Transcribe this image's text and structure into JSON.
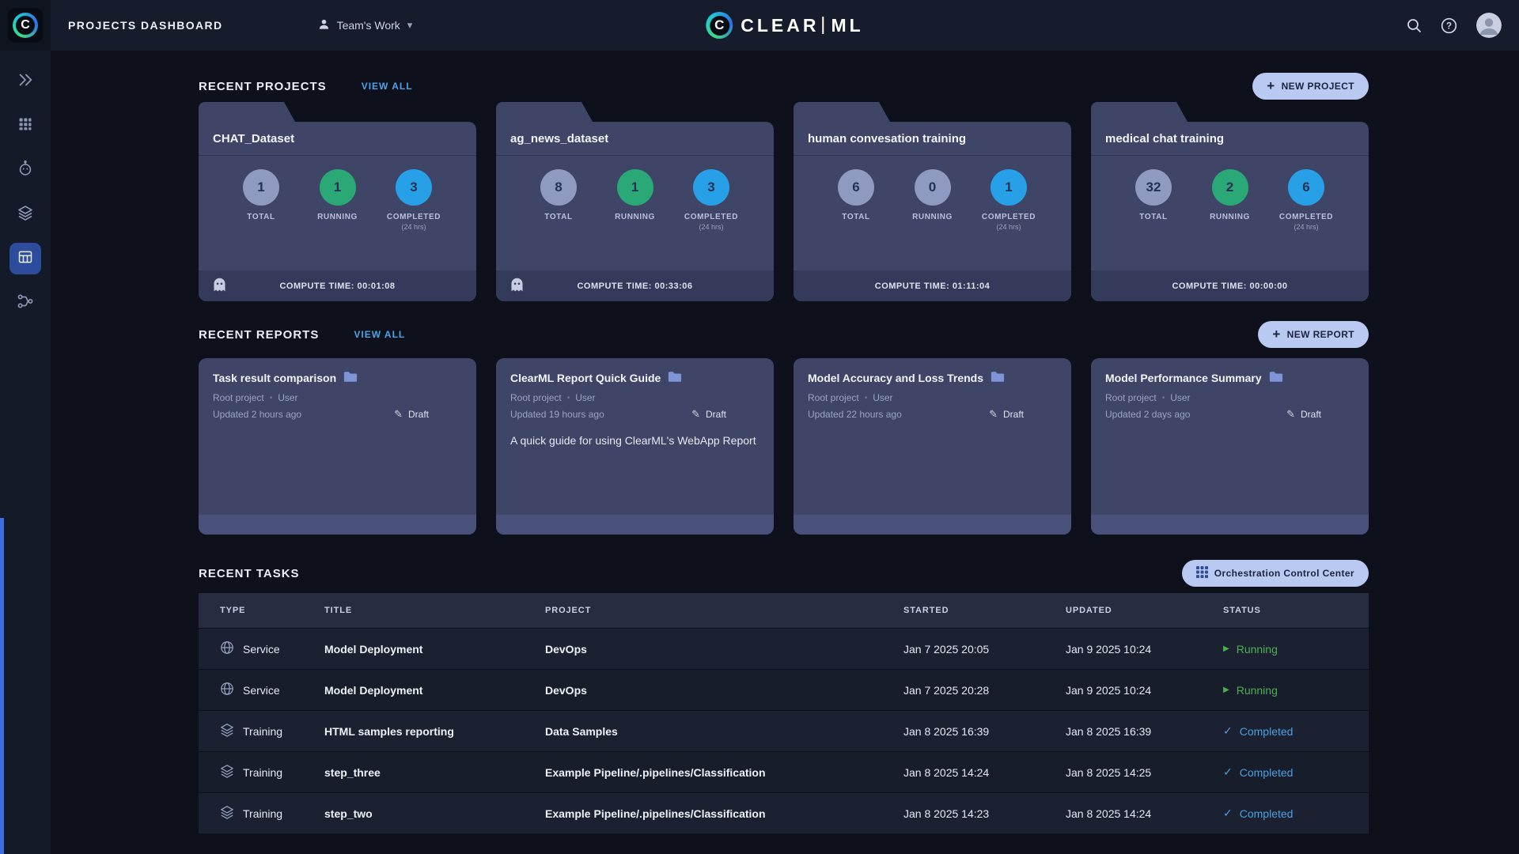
{
  "topbar": {
    "page_title": "PROJECTS DASHBOARD",
    "workspace": "Team's Work",
    "logo": {
      "c": "C",
      "word_left": "CLEAR",
      "word_right": "ML"
    }
  },
  "icons": {
    "caret_down": "▾",
    "plus": "+",
    "pencil": "✎",
    "dot": "•",
    "running": "▶",
    "completed": "✓"
  },
  "colors": {
    "accent_link": "#4ba3e8",
    "running_green": "#4caf50",
    "completed_blue": "#4aa0e0",
    "button_bg": "#b9c9f1",
    "total_gray": "#8e9ac0",
    "running_circle": "#2aa876",
    "completed_circle": "#28a0e8"
  },
  "sections": {
    "projects": {
      "title": "RECENT PROJECTS",
      "view_all": "VIEW ALL",
      "button": "NEW PROJECT"
    },
    "reports": {
      "title": "RECENT REPORTS",
      "view_all": "VIEW ALL",
      "button": "NEW REPORT"
    },
    "tasks": {
      "title": "RECENT TASKS",
      "button": "Orchestration Control Center"
    }
  },
  "stat_labels": {
    "total": "TOTAL",
    "running": "RUNNING",
    "completed": "COMPLETED",
    "completed_sub": "(24 hrs)",
    "compute": "COMPUTE TIME:"
  },
  "projects": [
    {
      "name": "CHAT_Dataset",
      "total": "1",
      "running": "1",
      "completed": "3",
      "compute_time": "00:01:08"
    },
    {
      "name": "ag_news_dataset",
      "total": "8",
      "running": "1",
      "completed": "3",
      "compute_time": "00:33:06"
    },
    {
      "name": "human convesation training",
      "total": "6",
      "running": "0",
      "completed": "1",
      "compute_time": "01:11:04"
    },
    {
      "name": "medical chat training",
      "total": "32",
      "running": "2",
      "completed": "6",
      "compute_time": "00:00:00"
    }
  ],
  "reports": [
    {
      "title": "Task result comparison",
      "project": "Root project",
      "author": "User",
      "updated": "Updated 2 hours ago",
      "status": "Draft",
      "description": ""
    },
    {
      "title": "ClearML Report Quick Guide",
      "project": "Root project",
      "author": "User",
      "updated": "Updated 19 hours ago",
      "status": "Draft",
      "description": "A quick guide for using ClearML's WebApp Report"
    },
    {
      "title": "Model Accuracy and Loss Trends",
      "project": "Root project",
      "author": "User",
      "updated": "Updated 22 hours ago",
      "status": "Draft",
      "description": ""
    },
    {
      "title": "Model Performance Summary",
      "project": "Root project",
      "author": "User",
      "updated": "Updated 2 days ago",
      "status": "Draft",
      "description": ""
    }
  ],
  "tasks": {
    "headers": [
      "TYPE",
      "TITLE",
      "PROJECT",
      "STARTED",
      "UPDATED",
      "STATUS"
    ],
    "rows": [
      {
        "type": "Service",
        "title": "Model Deployment",
        "project": "DevOps",
        "started": "Jan 7 2025 20:05",
        "updated": "Jan 9 2025 10:24",
        "status": "Running"
      },
      {
        "type": "Service",
        "title": "Model Deployment",
        "project": "DevOps",
        "started": "Jan 7 2025 20:28",
        "updated": "Jan 9 2025 10:24",
        "status": "Running"
      },
      {
        "type": "Training",
        "title": "HTML samples reporting",
        "project": "Data Samples",
        "started": "Jan 8 2025 16:39",
        "updated": "Jan 8 2025 16:39",
        "status": "Completed"
      },
      {
        "type": "Training",
        "title": "step_three",
        "project": "Example Pipeline/.pipelines/Classification",
        "started": "Jan 8 2025 14:24",
        "updated": "Jan 8 2025 14:25",
        "status": "Completed"
      },
      {
        "type": "Training",
        "title": "step_two",
        "project": "Example Pipeline/.pipelines/Classification",
        "started": "Jan 8 2025 14:23",
        "updated": "Jan 8 2025 14:24",
        "status": "Completed"
      }
    ]
  }
}
